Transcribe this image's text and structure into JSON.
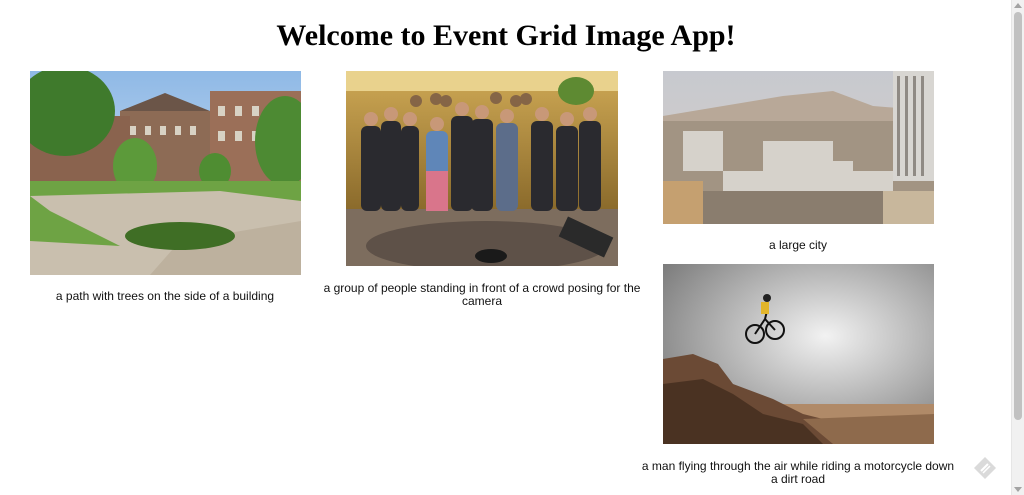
{
  "page": {
    "title": "Welcome to Event Grid Image App!"
  },
  "images": [
    {
      "caption": "a path with trees on the side of a building"
    },
    {
      "caption": "a group of people standing in front of a crowd posing for the camera"
    },
    {
      "caption": "a large city"
    },
    {
      "caption": "a man flying through the air while riding a motorcycle down a dirt road"
    }
  ],
  "floating_button": {
    "icon": "pencil-diamond-icon"
  },
  "colors": {
    "background": "#ffffff",
    "text": "#000000"
  }
}
